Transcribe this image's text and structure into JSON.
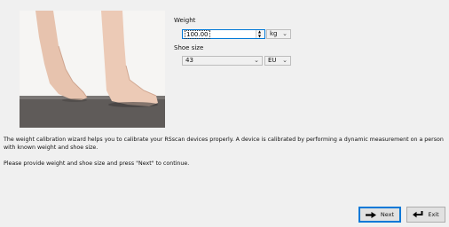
{
  "form": {
    "weight_label": "Weight",
    "weight_value": "100.00",
    "weight_unit": "kg",
    "shoe_size_label": "Shoe size",
    "shoe_size_value": "43",
    "shoe_size_system": "EU"
  },
  "description": {
    "line1": "The weight calibration wizard helps you to calibrate your RSscan devices properly. A device is calibrated by performing a dynamic measurement on a person",
    "line2": "with known weight and shoe size.",
    "instruction": "Please provide weight and shoe size and press \"Next\" to continue."
  },
  "buttons": {
    "next": "Next",
    "exit": "Exit"
  },
  "colors": {
    "background": "#f0f0f0",
    "focus_accent": "#0078d7",
    "floor": "#5f5b59"
  }
}
